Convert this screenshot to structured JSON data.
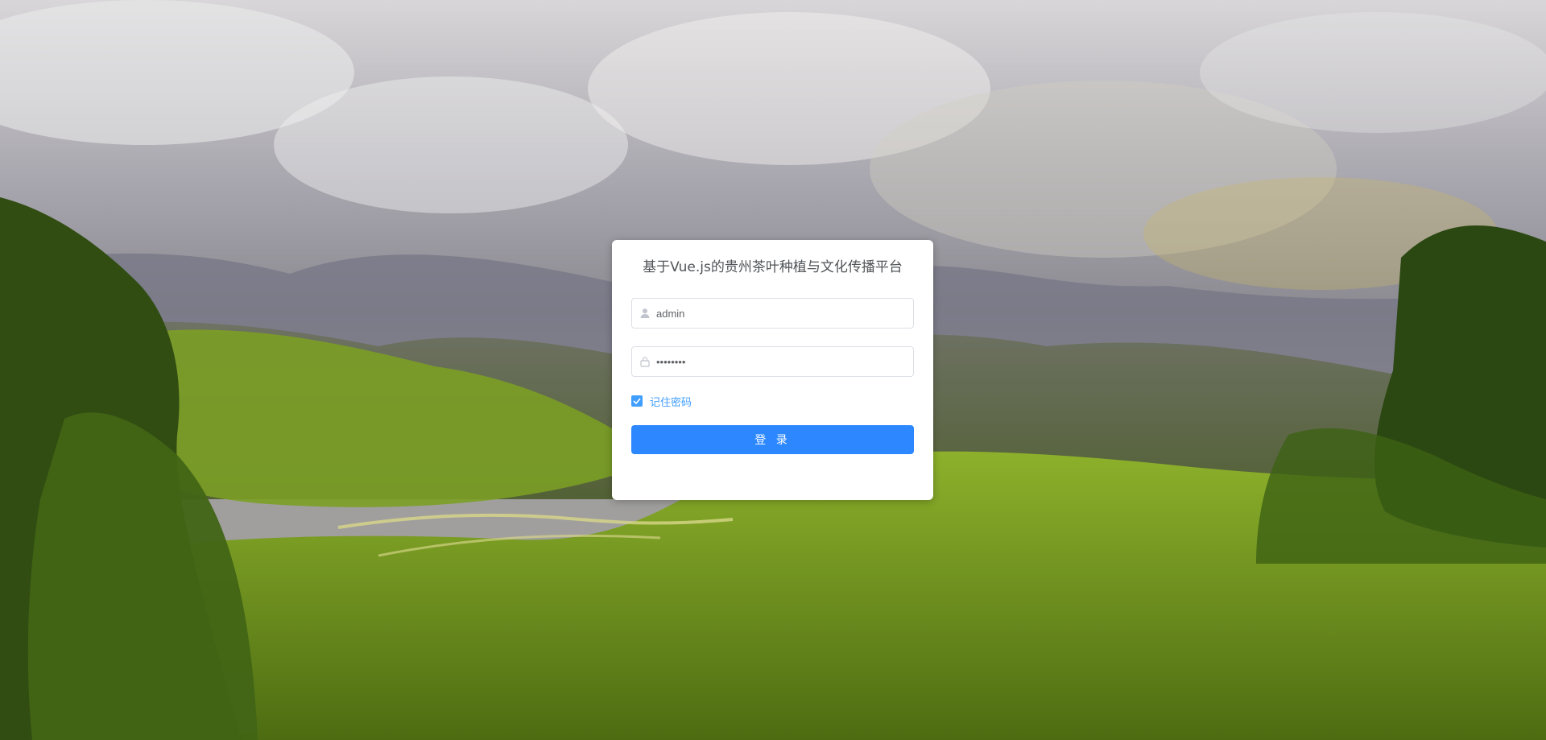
{
  "page": {
    "title": "基于Vue.js的贵州茶叶种植与文化传播平台"
  },
  "login": {
    "username_value": "admin",
    "password_value": "12345678",
    "remember_label": "记住密码",
    "remember_checked": true,
    "submit_label": "登 录"
  },
  "icons": {
    "username": "user-icon",
    "password": "lock-icon",
    "checkbox": "check-icon"
  },
  "colors": {
    "primary": "#409eff",
    "button": "#2d88ff",
    "card": "#ffffff",
    "input_border": "#dcdfe6",
    "text": "#505458"
  }
}
